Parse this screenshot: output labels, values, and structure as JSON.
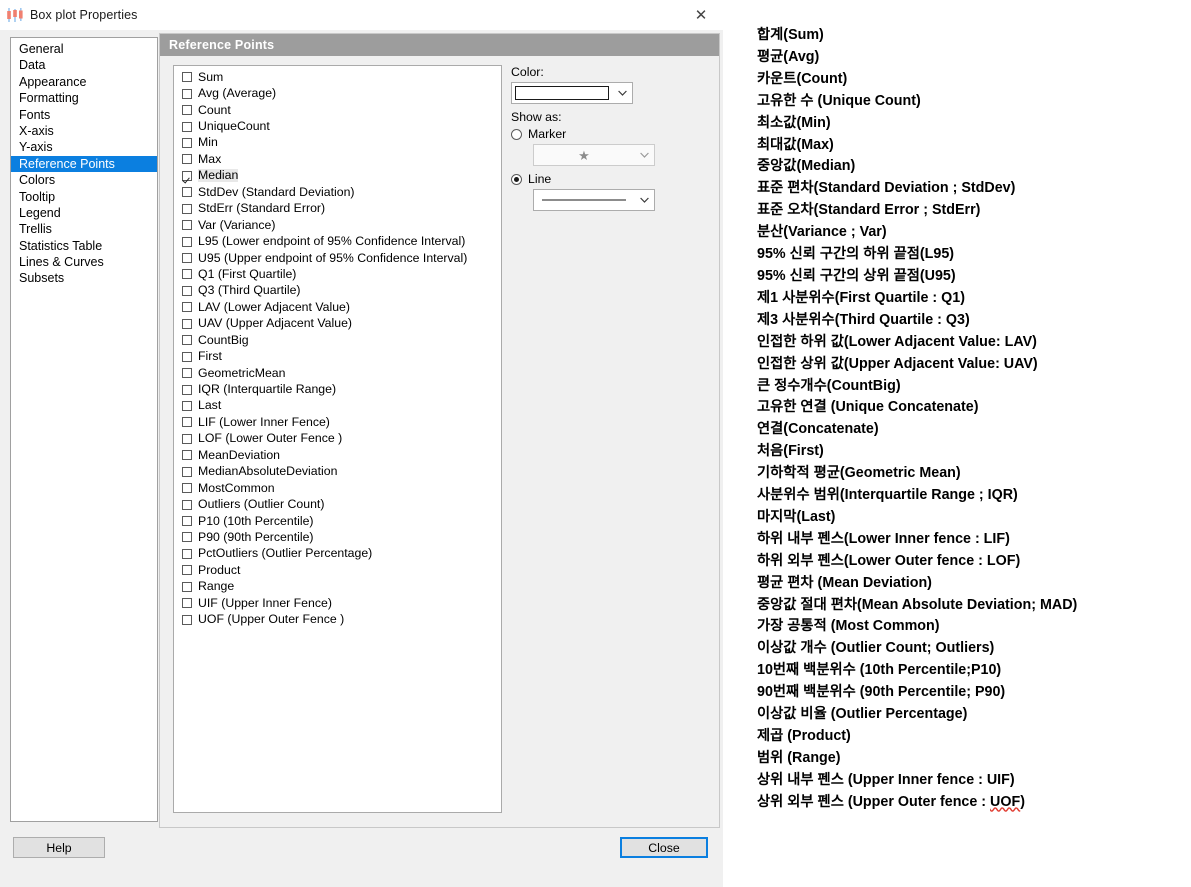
{
  "window": {
    "title": "Box plot Properties",
    "icon": "boxplot-icon",
    "close_glyph": "✕"
  },
  "categories": [
    {
      "label": "General",
      "selected": false
    },
    {
      "label": "Data",
      "selected": false
    },
    {
      "label": "Appearance",
      "selected": false
    },
    {
      "label": "Formatting",
      "selected": false
    },
    {
      "label": "Fonts",
      "selected": false
    },
    {
      "label": "X-axis",
      "selected": false
    },
    {
      "label": "Y-axis",
      "selected": false
    },
    {
      "label": "Reference Points",
      "selected": true
    },
    {
      "label": "Colors",
      "selected": false
    },
    {
      "label": "Tooltip",
      "selected": false
    },
    {
      "label": "Legend",
      "selected": false
    },
    {
      "label": "Trellis",
      "selected": false
    },
    {
      "label": "Statistics Table",
      "selected": false
    },
    {
      "label": "Lines & Curves",
      "selected": false
    },
    {
      "label": "Subsets",
      "selected": false
    }
  ],
  "panel": {
    "header": "Reference Points",
    "reference_points": [
      {
        "label": "Sum",
        "checked": false,
        "highlighted": false
      },
      {
        "label": "Avg (Average)",
        "checked": false,
        "highlighted": false
      },
      {
        "label": "Count",
        "checked": false,
        "highlighted": false
      },
      {
        "label": "UniqueCount",
        "checked": false,
        "highlighted": false
      },
      {
        "label": "Min",
        "checked": false,
        "highlighted": false
      },
      {
        "label": "Max",
        "checked": false,
        "highlighted": false
      },
      {
        "label": "Median",
        "checked": true,
        "highlighted": true
      },
      {
        "label": "StdDev (Standard Deviation)",
        "checked": false,
        "highlighted": false
      },
      {
        "label": "StdErr (Standard Error)",
        "checked": false,
        "highlighted": false
      },
      {
        "label": "Var (Variance)",
        "checked": false,
        "highlighted": false
      },
      {
        "label": "L95 (Lower endpoint of 95% Confidence Interval)",
        "checked": false,
        "highlighted": false
      },
      {
        "label": "U95 (Upper endpoint of 95% Confidence Interval)",
        "checked": false,
        "highlighted": false
      },
      {
        "label": "Q1 (First Quartile)",
        "checked": false,
        "highlighted": false
      },
      {
        "label": "Q3 (Third Quartile)",
        "checked": false,
        "highlighted": false
      },
      {
        "label": "LAV (Lower Adjacent Value)",
        "checked": false,
        "highlighted": false
      },
      {
        "label": "UAV (Upper Adjacent Value)",
        "checked": false,
        "highlighted": false
      },
      {
        "label": "CountBig",
        "checked": false,
        "highlighted": false
      },
      {
        "label": "First",
        "checked": false,
        "highlighted": false
      },
      {
        "label": "GeometricMean",
        "checked": false,
        "highlighted": false
      },
      {
        "label": "IQR (Interquartile Range)",
        "checked": false,
        "highlighted": false
      },
      {
        "label": "Last",
        "checked": false,
        "highlighted": false
      },
      {
        "label": "LIF (Lower Inner Fence)",
        "checked": false,
        "highlighted": false
      },
      {
        "label": "LOF (Lower Outer Fence )",
        "checked": false,
        "highlighted": false
      },
      {
        "label": "MeanDeviation",
        "checked": false,
        "highlighted": false
      },
      {
        "label": "MedianAbsoluteDeviation",
        "checked": false,
        "highlighted": false
      },
      {
        "label": "MostCommon",
        "checked": false,
        "highlighted": false
      },
      {
        "label": "Outliers (Outlier Count)",
        "checked": false,
        "highlighted": false
      },
      {
        "label": "P10 (10th Percentile)",
        "checked": false,
        "highlighted": false
      },
      {
        "label": "P90 (90th Percentile)",
        "checked": false,
        "highlighted": false
      },
      {
        "label": "PctOutliers (Outlier Percentage)",
        "checked": false,
        "highlighted": false
      },
      {
        "label": "Product",
        "checked": false,
        "highlighted": false
      },
      {
        "label": "Range",
        "checked": false,
        "highlighted": false
      },
      {
        "label": "UIF (Upper Inner Fence)",
        "checked": false,
        "highlighted": false
      },
      {
        "label": "UOF (Upper Outer Fence )",
        "checked": false,
        "highlighted": false
      }
    ],
    "controls": {
      "color_label": "Color:",
      "color_value": "#ffffff",
      "show_as_label": "Show as:",
      "marker_label": "Marker",
      "marker_selected": false,
      "marker_glyph": "★",
      "line_label": "Line",
      "line_selected": true,
      "dropdown_arrow": "⌄"
    }
  },
  "footer": {
    "help_label": "Help",
    "close_label": "Close"
  },
  "glossary": [
    "합계(Sum)",
    "평균(Avg)",
    "카운트(Count)",
    "고유한 수 (Unique Count)",
    "최소값(Min)",
    "최대값(Max)",
    "중앙값(Median)",
    "표준 편차(Standard Deviation ; StdDev)",
    "표준 오차(Standard Error ; StdErr)",
    "분산(Variance ; Var)",
    "95% 신뢰 구간의 하위 끝점(L95)",
    "95% 신뢰 구간의 상위 끝점(U95)",
    "제1 사분위수(First Quartile : Q1)",
    "제3 사분위수(Third Quartile : Q3)",
    "인접한 하위 값(Lower Adjacent Value: LAV)",
    "인접한 상위 값(Upper Adjacent Value: UAV)",
    "큰 정수개수(CountBig)",
    "고유한 연결 (Unique Concatenate)",
    "연결(Concatenate)",
    "처음(First)",
    "기하학적 평균(Geometric Mean)",
    "사분위수 범위(Interquartile Range ; IQR)",
    "마지막(Last)",
    "하위 내부 펜스(Lower Inner fence : LIF)",
    "하위 외부 펜스(Lower Outer fence : LOF)",
    "평균 편차 (Mean Deviation)",
    "중앙값 절대 편차(Mean Absolute Deviation; MAD)",
    "가장 공통적 (Most Common)",
    "이상값 개수 (Outlier Count; Outliers)",
    "10번째 백분위수 (10th Percentile;P10)",
    "90번째 백분위수 (90th Percentile; P90)",
    "이상값 비율 (Outlier Percentage)",
    "제곱 (Product)",
    "범위 (Range)",
    "상위 내부 펜스 (Upper Inner fence : UIF)",
    "상위 외부 펜스 (Upper Outer fence : UOF)"
  ],
  "glossary_misspelled_last_token": "UOF"
}
